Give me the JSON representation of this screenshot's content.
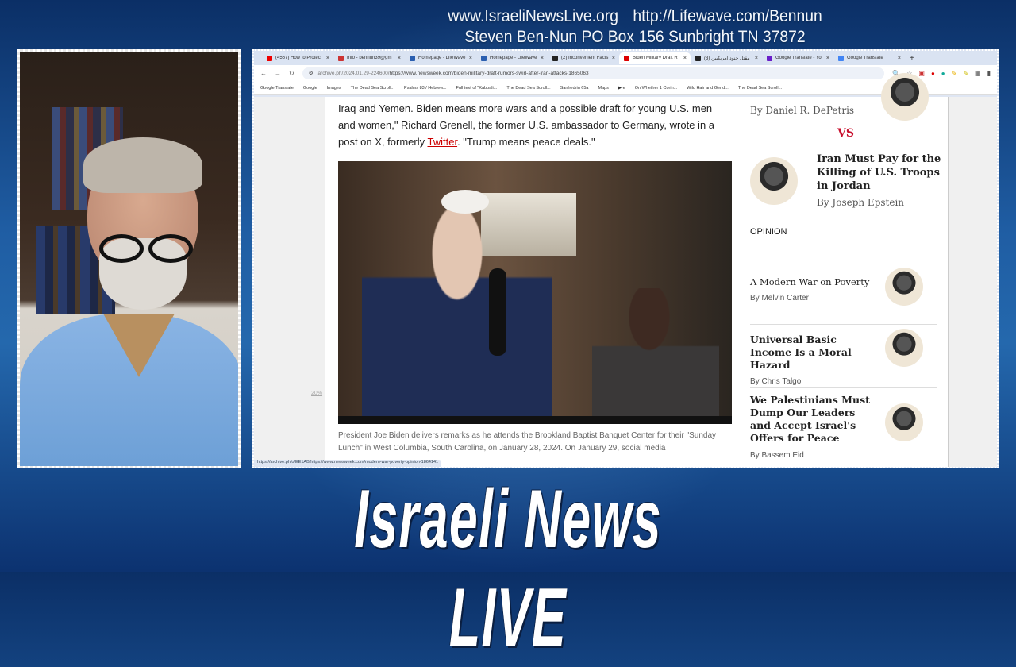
{
  "overlay": {
    "website": "www.IsraeliNewsLive.org",
    "lifewave": "http://Lifewave.com/Bennun",
    "address": "Steven Ben-Nun PO Box 156 Sunbright TN 37872",
    "logo_main": "Israeli News ",
    "logo_live": "LIVE"
  },
  "browser": {
    "tabs": [
      {
        "label": "(4567) How to Protec",
        "color": "#e00"
      },
      {
        "label": "Info - bennun39@gm",
        "color": "#c33"
      },
      {
        "label": "Homepage - LifeWave",
        "color": "#2b5fb0"
      },
      {
        "label": "Homepage - LifeWave",
        "color": "#2b5fb0"
      },
      {
        "label": "(2) Inconvenient Facts",
        "color": "#222"
      },
      {
        "label": "Biden Military Draft R",
        "color": "#d00",
        "active": true
      },
      {
        "label": "(3) مقتل جنود أمريكيين",
        "color": "#222"
      },
      {
        "label": "Google Translate - Yo",
        "color": "#6a1fc9"
      },
      {
        "label": "Google Translate",
        "color": "#4285f4"
      }
    ],
    "new_tab": "+",
    "url_host": "archive.ph/2024.01.29-224600/",
    "url_path": "https://www.newsweek.com/biden-military-draft-rumors-swirl-after-iran-attacks-1865063",
    "bookmarks": [
      "Google Translate",
      "Google",
      "Images",
      "The Dead Sea Scroll...",
      "Psalms 83 / Hebrew...",
      "Full text of \"Kabbali...",
      "The Dead Sea Scroll...",
      "Sanhedrin 65a",
      "Maps",
      "▶ e",
      "On Whether 1 Corin...",
      "Wild Hair and Gend...",
      "The Dead Sea Scroll..."
    ],
    "status_url": "https://archive.ph/o/EE1AB/https://www.newsweek.com/modern-war-poverty-opinion-1864141"
  },
  "article": {
    "para_before_link": "Iraq and Yemen. Biden means more wars and a possible draft for young U.S. men and women,\" Richard Grenell, the former U.S. ambassador to Germany, wrote in a post on X, formerly ",
    "link": "Twitter",
    "para_after_link": ". \"Trump means peace deals.\"",
    "caption": "President Joe Biden delivers remarks as he attends the Brookland Baptist Banquet Center for their \"Sunday Lunch\" in West Columbia, South Carolina, on January 28, 2024. On January 29, social media",
    "zoom_marker": "20%"
  },
  "sidebar": {
    "byline1": "By Daniel R. DePetris",
    "vs": "VS",
    "headline2": "Iran Must Pay for the Killing of U.S. Troops in Jordan",
    "byline2": "By Joseph Epstein",
    "section": "OPINION",
    "opinions": [
      {
        "title": "A Modern War on Poverty",
        "author": "By Melvin Carter"
      },
      {
        "title": "Universal Basic Income Is a Moral Hazard",
        "author": "By Chris Talgo"
      },
      {
        "title": "We Palestinians Must Dump Our Leaders and Accept Israel's Offers for Peace",
        "author": "By Bassem Eid"
      }
    ],
    "vs_color": "#c8102e"
  }
}
